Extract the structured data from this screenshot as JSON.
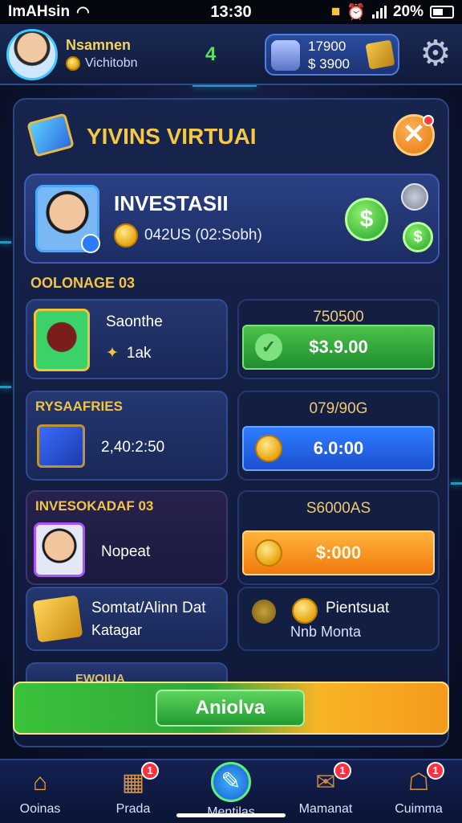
{
  "status_bar": {
    "carrier": "ImAHsin",
    "time": "13:30",
    "battery": "20%"
  },
  "header": {
    "player_name": "Nsamnen",
    "player_sub": "Vichitobn",
    "level": "4",
    "wallet_amount_1": "17900",
    "wallet_amount_2": "$ 3900"
  },
  "panel": {
    "title": "YIVINS VIRTUAI",
    "invest": {
      "title": "INVESTASII",
      "subtitle": "042US (02:Sobh)"
    },
    "sections": [
      "OOLONAGE 03",
      "RYSAAFRIES",
      "INVESOKADAF 03"
    ],
    "items": [
      {
        "title": "Saonthe",
        "sub": "1ak",
        "price_label": "750500",
        "button": "$3.9.00",
        "color": "#3bb33b"
      },
      {
        "title": "",
        "sub": "2,40:2:50",
        "price_label": "079/90G",
        "button": "6.0:00",
        "color": "#2c6fff"
      },
      {
        "title": "",
        "sub": "Nopeat",
        "price_label": "S6000AS",
        "button": "$:000",
        "color": "#f59a1c"
      }
    ],
    "extras": [
      {
        "title": "Somtat/Alinn Dat",
        "sub": "Katagar"
      },
      {
        "title": "Pientsuat",
        "sub": "Nnb Monta"
      }
    ],
    "peek_label": "EWOIUA",
    "cta": "Aniolva"
  },
  "nav": [
    {
      "label": "Ooinas",
      "icon": "home-icon",
      "badge": ""
    },
    {
      "label": "Prada",
      "icon": "shop-icon",
      "badge": "1"
    },
    {
      "label": "Mentilas",
      "icon": "invest-icon",
      "badge": ""
    },
    {
      "label": "Mamanat",
      "icon": "mail-icon",
      "badge": "1"
    },
    {
      "label": "Cuimma",
      "icon": "bag-icon",
      "badge": "1"
    }
  ]
}
